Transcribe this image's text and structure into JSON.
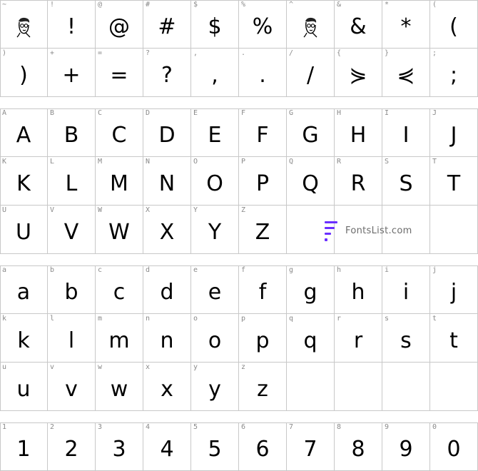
{
  "watermark": {
    "text": "FontsList.com",
    "brand_color": "#6a2fff"
  },
  "blocks": [
    {
      "name": "symbols",
      "rows": [
        [
          {
            "key": "~",
            "glyph": "",
            "icon": "cartoon-face"
          },
          {
            "key": "!",
            "glyph": "!"
          },
          {
            "key": "@",
            "glyph": "@"
          },
          {
            "key": "#",
            "glyph": "#"
          },
          {
            "key": "$",
            "glyph": "$"
          },
          {
            "key": "%",
            "glyph": "%"
          },
          {
            "key": "^",
            "glyph": "",
            "icon": "cartoon-face"
          },
          {
            "key": "&",
            "glyph": "&"
          },
          {
            "key": "*",
            "glyph": "*"
          },
          {
            "key": "(",
            "glyph": "("
          }
        ],
        [
          {
            "key": ")",
            "glyph": ")"
          },
          {
            "key": "+",
            "glyph": "+"
          },
          {
            "key": "=",
            "glyph": "="
          },
          {
            "key": "?",
            "glyph": "?"
          },
          {
            "key": ",",
            "glyph": ","
          },
          {
            "key": ".",
            "glyph": "."
          },
          {
            "key": "/",
            "glyph": "/"
          },
          {
            "key": "{",
            "glyph": "⋟"
          },
          {
            "key": "}",
            "glyph": "⋞"
          },
          {
            "key": ";",
            "glyph": ";"
          }
        ]
      ]
    },
    {
      "name": "uppercase",
      "rows": [
        [
          {
            "key": "A",
            "glyph": "A"
          },
          {
            "key": "B",
            "glyph": "B"
          },
          {
            "key": "C",
            "glyph": "C"
          },
          {
            "key": "D",
            "glyph": "D"
          },
          {
            "key": "E",
            "glyph": "E"
          },
          {
            "key": "F",
            "glyph": "F"
          },
          {
            "key": "G",
            "glyph": "G"
          },
          {
            "key": "H",
            "glyph": "H"
          },
          {
            "key": "I",
            "glyph": "I"
          },
          {
            "key": "J",
            "glyph": "J"
          }
        ],
        [
          {
            "key": "K",
            "glyph": "K"
          },
          {
            "key": "L",
            "glyph": "L"
          },
          {
            "key": "M",
            "glyph": "M"
          },
          {
            "key": "N",
            "glyph": "N"
          },
          {
            "key": "O",
            "glyph": "O"
          },
          {
            "key": "P",
            "glyph": "P"
          },
          {
            "key": "Q",
            "glyph": "Q"
          },
          {
            "key": "R",
            "glyph": "R"
          },
          {
            "key": "S",
            "glyph": "S"
          },
          {
            "key": "T",
            "glyph": "T"
          }
        ],
        [
          {
            "key": "U",
            "glyph": "U"
          },
          {
            "key": "V",
            "glyph": "V"
          },
          {
            "key": "W",
            "glyph": "W"
          },
          {
            "key": "X",
            "glyph": "X"
          },
          {
            "key": "Y",
            "glyph": "Y"
          },
          {
            "key": "Z",
            "glyph": "Z"
          }
        ]
      ]
    },
    {
      "name": "lowercase",
      "rows": [
        [
          {
            "key": "a",
            "glyph": "a"
          },
          {
            "key": "b",
            "glyph": "b"
          },
          {
            "key": "c",
            "glyph": "c"
          },
          {
            "key": "d",
            "glyph": "d"
          },
          {
            "key": "e",
            "glyph": "e"
          },
          {
            "key": "f",
            "glyph": "f"
          },
          {
            "key": "g",
            "glyph": "g"
          },
          {
            "key": "h",
            "glyph": "h"
          },
          {
            "key": "i",
            "glyph": "i"
          },
          {
            "key": "j",
            "glyph": "j"
          }
        ],
        [
          {
            "key": "k",
            "glyph": "k"
          },
          {
            "key": "l",
            "glyph": "l"
          },
          {
            "key": "m",
            "glyph": "m"
          },
          {
            "key": "n",
            "glyph": "n"
          },
          {
            "key": "o",
            "glyph": "o"
          },
          {
            "key": "p",
            "glyph": "p"
          },
          {
            "key": "q",
            "glyph": "q"
          },
          {
            "key": "r",
            "glyph": "r"
          },
          {
            "key": "s",
            "glyph": "s"
          },
          {
            "key": "t",
            "glyph": "t"
          }
        ],
        [
          {
            "key": "u",
            "glyph": "u"
          },
          {
            "key": "v",
            "glyph": "v"
          },
          {
            "key": "w",
            "glyph": "w"
          },
          {
            "key": "x",
            "glyph": "x"
          },
          {
            "key": "y",
            "glyph": "y"
          },
          {
            "key": "z",
            "glyph": "z"
          }
        ]
      ]
    },
    {
      "name": "digits",
      "rows": [
        [
          {
            "key": "1",
            "glyph": "1"
          },
          {
            "key": "2",
            "glyph": "2"
          },
          {
            "key": "3",
            "glyph": "3"
          },
          {
            "key": "4",
            "glyph": "4"
          },
          {
            "key": "5",
            "glyph": "5"
          },
          {
            "key": "6",
            "glyph": "6"
          },
          {
            "key": "7",
            "glyph": "7"
          },
          {
            "key": "8",
            "glyph": "8"
          },
          {
            "key": "9",
            "glyph": "9"
          },
          {
            "key": "0",
            "glyph": "0"
          }
        ]
      ]
    }
  ]
}
